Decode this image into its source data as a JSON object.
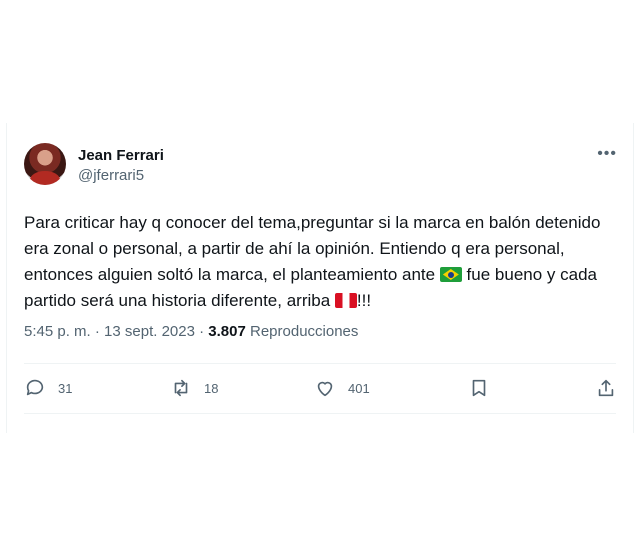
{
  "author": {
    "name": "Jean Ferrari",
    "handle": "@jferrari5"
  },
  "tweet": {
    "text_part1": "Para criticar hay q conocer del tema,preguntar si la marca en balón detenido era zonal o personal, a partir de ahí la opinión. Entiendo q era personal, entonces alguien soltó la marca, el planteamiento ante ",
    "text_part2": " fue bueno y cada partido será una historia diferente, arriba ",
    "text_part3": "!!!"
  },
  "meta": {
    "time_date": "5:45 p. m. · 13 sept. 2023 · ",
    "views_count": "3.807",
    "views_label": " Reproducciones"
  },
  "actions": {
    "replies": "31",
    "retweets": "18",
    "likes": "401"
  },
  "icons": [
    "more-icon",
    "reply-icon",
    "retweet-icon",
    "like-icon",
    "bookmark-icon",
    "share-icon",
    "brazil-flag-icon",
    "peru-flag-icon"
  ]
}
